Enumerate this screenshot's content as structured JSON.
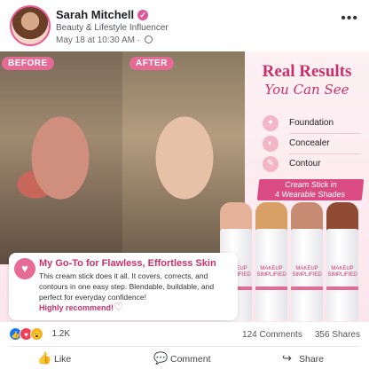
{
  "post": {
    "author": "Sarah Mitchell",
    "subtitle": "Beauty & Lifestyle Influencer",
    "timestamp": "May 18 at 10:30 AM ·",
    "verified_icon": "check-icon",
    "menu_icon": "more-icon"
  },
  "image": {
    "before_label": "BEFORE",
    "after_label": "AFTER",
    "headline": "Real Results",
    "headline_script": "You Can See",
    "features": [
      {
        "label": "Foundation",
        "icon": "sparkle-icon"
      },
      {
        "label": "Concealer",
        "icon": "compact-icon"
      },
      {
        "label": "Contour",
        "icon": "brush-icon"
      }
    ],
    "banner_line1": "Cream Stick in",
    "banner_line2": "4 Wearable Shades",
    "product_brand": "MAKEUP SIMPLIFIED",
    "shades": [
      "#e6b29a",
      "#d8a064",
      "#c58c73",
      "#8f4b34"
    ],
    "quote_title": "My Go-To for Flawless, Effortless Skin",
    "quote_body": "This cream stick does it all. It covers, corrects, and contours in one easy step. Blendable, buildable, and perfect for everyday confidence!",
    "quote_cta": "Highly recommend!"
  },
  "engagement": {
    "reaction_count": "1.2K",
    "comments": "124 Comments",
    "shares": "356 Shares"
  },
  "actions": {
    "like": "Like",
    "comment": "Comment",
    "share": "Share"
  },
  "colors": {
    "accent": "#c8326a",
    "tag": "#e56b95",
    "like_blue": "#1877f2"
  }
}
